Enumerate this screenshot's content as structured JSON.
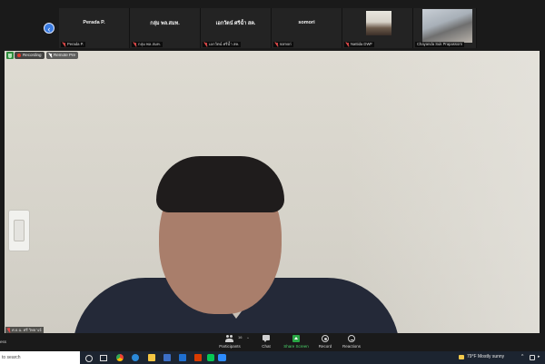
{
  "gallery": {
    "tiles": [
      {
        "name": "Perada P.",
        "label": "Perada P."
      },
      {
        "name": "กลุ่ม พล.สมท.",
        "label": "กลุ่ม พล.สมท."
      },
      {
        "name": "เอกวัตน์ ศรีฉ้ำ สค.",
        "label": "เอกวัตน์ ศรีฉ้ำ สค."
      },
      {
        "name": "somori",
        "label": "somori"
      },
      {
        "name": "",
        "label": "Nattida DWF"
      },
      {
        "name": "",
        "label": "Chayanda Suk Prapassorn"
      }
    ]
  },
  "main_video": {
    "recording_label": "Recording",
    "remote_label": "Remote Pre",
    "speaker_label": "ศ.ธ.ฉ. ศรี วิทยาเจ้"
  },
  "toolbar": {
    "left_text": "ess",
    "participants_label": "Participants",
    "participants_count": "16",
    "chat_label": "Chat",
    "share_label": "Share Screen",
    "record_label": "Record",
    "reactions_label": "Reactions"
  },
  "taskbar": {
    "search_placeholder": "to search",
    "weather": "79°F  Mostly sunny"
  },
  "colors": {
    "accent_blue": "#3a7be0",
    "share_green": "#29a745",
    "mute_red": "#e24a4a",
    "toolbar_bg": "#1a1a1a",
    "taskbar_bg": "#1c2430"
  }
}
